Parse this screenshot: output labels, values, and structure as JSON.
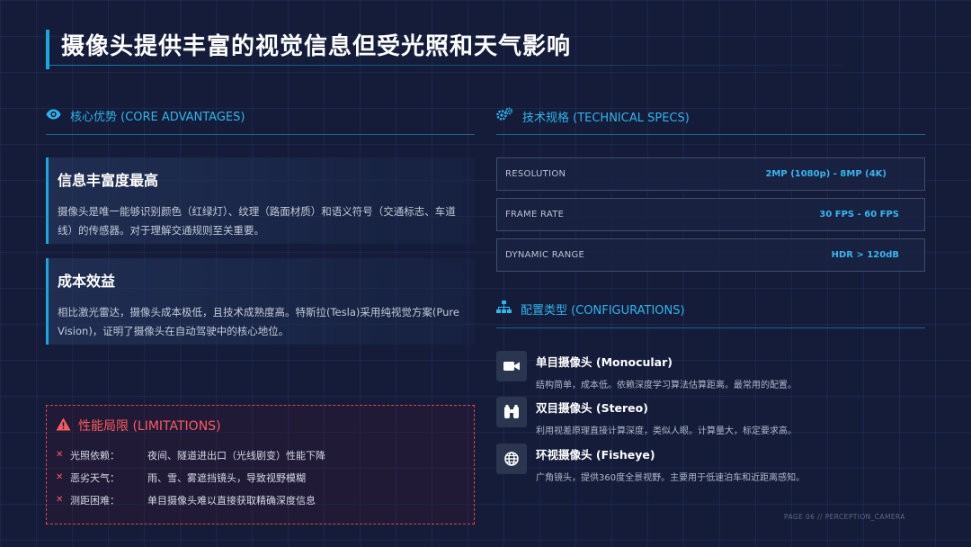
{
  "title": "摄像头提供丰富的视觉信息但受光照和天气影响",
  "advantages": {
    "heading": "核心优势 (CORE ADVANTAGES)",
    "icon": "eye-icon",
    "cards": [
      {
        "title": "信息丰富度最高",
        "text": "摄像头是唯一能够识别颜色（红绿灯）、纹理（路面材质）和语义符号（交通标志、车道线）的传感器。对于理解交通规则至关重要。"
      },
      {
        "title": "成本效益",
        "text": "相比激光雷达，摄像头成本极低，且技术成熟度高。特斯拉(Tesla)采用纯视觉方案(Pure Vision)，证明了摄像头在自动驾驶中的核心地位。"
      }
    ]
  },
  "limitations": {
    "heading": "性能局限 (LIMITATIONS)",
    "icon": "warning-icon",
    "items": [
      {
        "label": "光照依赖：",
        "value": "夜间、隧道进出口（光线剧变）性能下降"
      },
      {
        "label": "恶劣天气：",
        "value": "雨、雪、雾遮挡镜头，导致视野模糊"
      },
      {
        "label": "测距困难：",
        "value": "单目摄像头难以直接获取精确深度信息"
      }
    ]
  },
  "specs": {
    "heading": "技术规格 (TECHNICAL SPECS)",
    "icon": "gears-icon",
    "rows": [
      {
        "label": "RESOLUTION",
        "value": "2MP (1080p) - 8MP (4K)"
      },
      {
        "label": "FRAME RATE",
        "value": "30 FPS - 60 FPS"
      },
      {
        "label": "DYNAMIC RANGE",
        "value": "HDR > 120dB"
      }
    ]
  },
  "configurations": {
    "heading": "配置类型 (CONFIGURATIONS)",
    "icon": "sitemap-icon",
    "items": [
      {
        "icon": "video-camera-icon",
        "title": "单目摄像头 (Monocular)",
        "desc": "结构简单，成本低。依赖深度学习算法估算距离。最常用的配置。"
      },
      {
        "icon": "binoculars-icon",
        "title": "双目摄像头 (Stereo)",
        "desc": "利用视差原理直接计算深度，类似人眼。计算量大，标定要求高。"
      },
      {
        "icon": "globe-icon",
        "title": "环视摄像头 (Fisheye)",
        "desc": "广角镜头，提供360度全景视野。主要用于低速泊车和近距离感知。"
      }
    ]
  },
  "footer": "PAGE 06 // PERCEPTION_CAMERA",
  "colors": {
    "accent": "#19a7e0",
    "warning": "#e0444a",
    "background": "#141c3a"
  }
}
